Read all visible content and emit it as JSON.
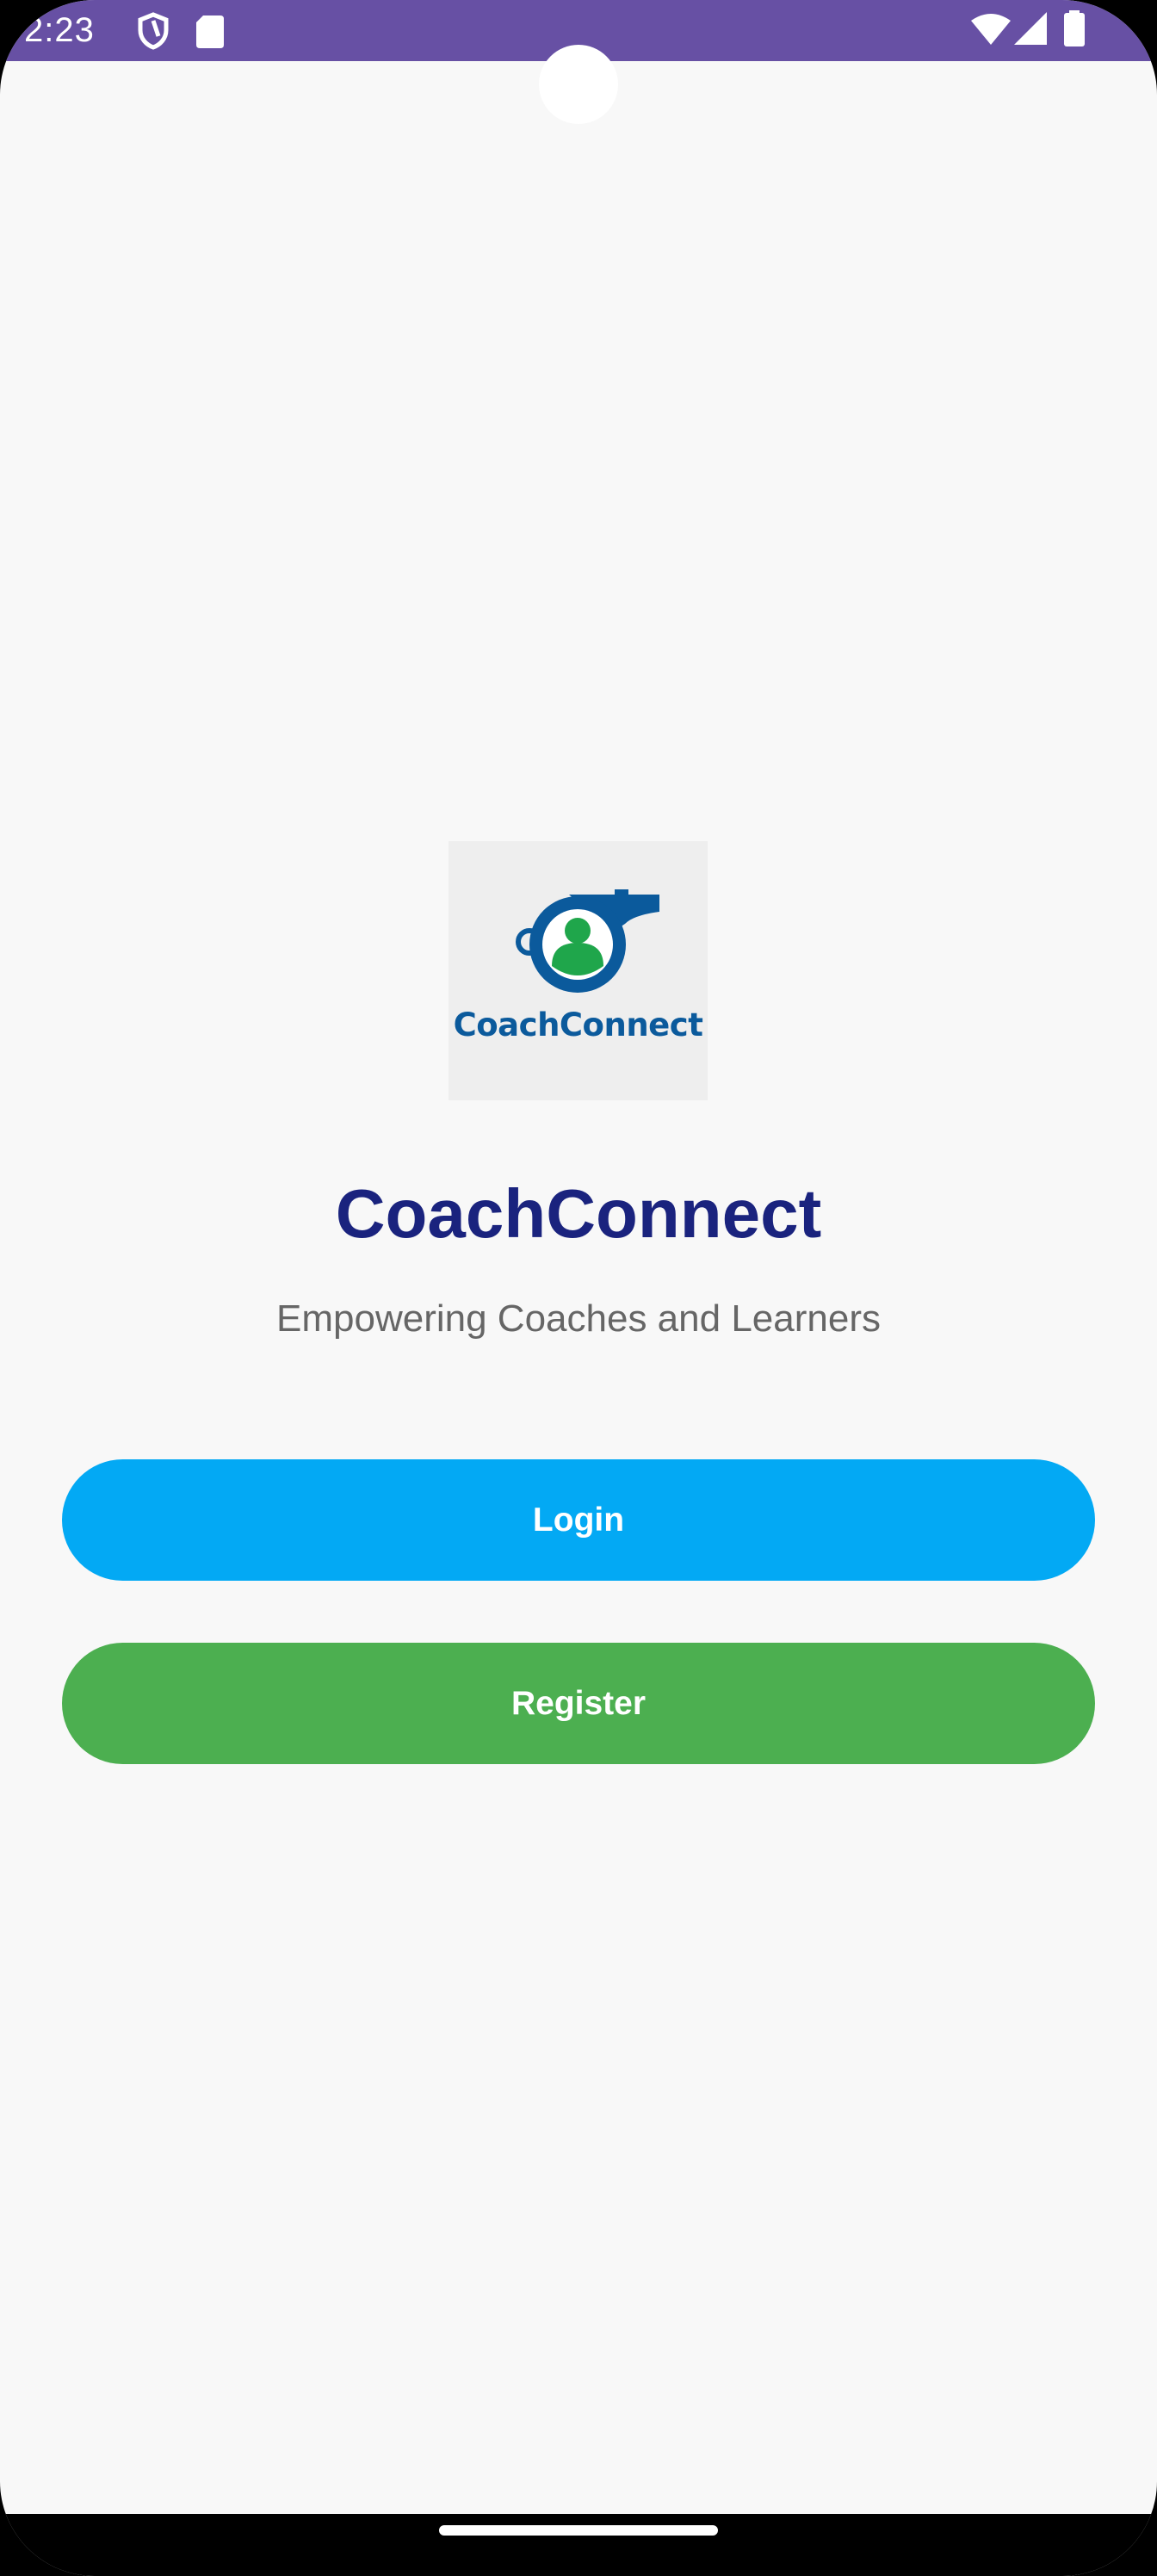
{
  "status_bar": {
    "time": "2:23",
    "icons": [
      "shield-icon",
      "sd-card-icon",
      "wifi-icon",
      "cell-signal-icon",
      "battery-icon"
    ],
    "color": "#6750a4"
  },
  "logo": {
    "wordmark": "CoachConnect",
    "colors": {
      "navy": "#0b5a9c",
      "green": "#1fa64b"
    }
  },
  "title": "CoachConnect",
  "subtitle": "Empowering Coaches and Learners",
  "buttons": {
    "login_label": "Login",
    "register_label": "Register"
  },
  "colors": {
    "background": "#f8f8f8",
    "title": "#1a237e",
    "subtitle": "#666666",
    "login": "#03a9f4",
    "register": "#4caf50"
  }
}
